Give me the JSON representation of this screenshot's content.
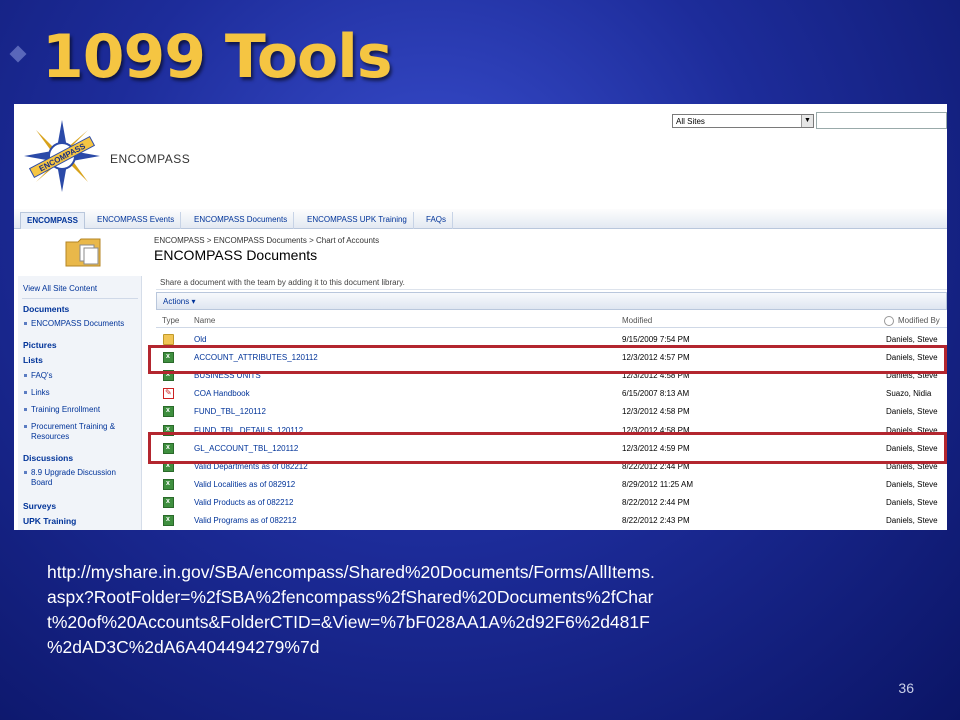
{
  "slide": {
    "title": "1099 Tools",
    "url": "http://myshare.in.gov/SBA/encompass/Shared%20Documents/Forms/AllItems.aspx?RootFolder=%2fSBA%2fencompass%2fShared%20Documents%2fChart%20of%20Accounts&FolderCTID=&View=%7bF028AA1A%2d92F6%2d481F%2dAD3C%2dA6A404494279%7d",
    "url_lines": [
      "http://myshare.in.gov/SBA/encompass/Shared%20Documents/Forms/AllItems.",
      "aspx?RootFolder=%2fSBA%2fencompass%2fShared%20Documents%2fChar",
      "t%20of%20Accounts&FolderCTID=&View=%7bF028AA1A%2d92F6%2d481F",
      "%2dAD3C%2dA6A404494279%7d"
    ],
    "page_number": "36",
    "colors": {
      "title": "#f5c542",
      "highlight": "#b3262f",
      "background": "#1d2c9a"
    }
  },
  "sharepoint": {
    "site_name": "ENCOMPASS",
    "logo_text": "ENCOMPASS",
    "search_scope": "All Sites",
    "tabs": [
      "ENCOMPASS",
      "ENCOMPASS Events",
      "ENCOMPASS Documents",
      "ENCOMPASS UPK Training",
      "FAQs"
    ],
    "active_tab": "ENCOMPASS",
    "breadcrumb": "ENCOMPASS > ENCOMPASS Documents > Chart of Accounts",
    "library_title": "ENCOMPASS Documents",
    "description": "Share a document with the team by adding it to this document library.",
    "actions_label": "Actions ▾",
    "columns": {
      "type": "Type",
      "name": "Name",
      "modified": "Modified",
      "modified_by": "Modified By"
    },
    "quicklaunch": {
      "view_all": "View All Site Content",
      "documents_head": "Documents",
      "documents_items": [
        "ENCOMPASS Documents"
      ],
      "pictures_head": "Pictures",
      "lists_head": "Lists",
      "lists_items": [
        "FAQ's",
        "Links",
        "Training Enrollment",
        "Procurement Training & Resources"
      ],
      "discussions_head": "Discussions",
      "discussions_items": [
        "8.9 Upgrade Discussion Board"
      ],
      "surveys_head": "Surveys",
      "upk_head": "UPK Training"
    },
    "rows": [
      {
        "icon": "folder",
        "name": "Old",
        "modified": "9/15/2009 7:54 PM",
        "by": "Daniels, Steve"
      },
      {
        "icon": "xls",
        "name": "ACCOUNT_ATTRIBUTES_120112",
        "modified": "12/3/2012 4:57 PM",
        "by": "Daniels, Steve"
      },
      {
        "icon": "xls",
        "name": "BUSINESS UNITS",
        "modified": "12/3/2012 4:58 PM",
        "by": "Daniels, Steve"
      },
      {
        "icon": "pdf",
        "name": "COA Handbook",
        "modified": "6/15/2007 8:13 AM",
        "by": "Suazo, Nidia"
      },
      {
        "icon": "xls",
        "name": "FUND_TBL_120112",
        "modified": "12/3/2012 4:58 PM",
        "by": "Daniels, Steve"
      },
      {
        "icon": "xls",
        "name": "FUND_TBL_DETAILS_120112",
        "modified": "12/3/2012 4:58 PM",
        "by": "Daniels, Steve"
      },
      {
        "icon": "xls",
        "name": "GL_ACCOUNT_TBL_120112",
        "modified": "12/3/2012 4:59 PM",
        "by": "Daniels, Steve"
      },
      {
        "icon": "xls",
        "name": "Valid Departments as of 082212",
        "modified": "8/22/2012 2:44 PM",
        "by": "Daniels, Steve"
      },
      {
        "icon": "xls",
        "name": "Valid Localities as of 082912",
        "modified": "8/29/2012 11:25 AM",
        "by": "Daniels, Steve"
      },
      {
        "icon": "xls",
        "name": "Valid Products as of 082212",
        "modified": "8/22/2012 2:44 PM",
        "by": "Daniels, Steve"
      },
      {
        "icon": "xls",
        "name": "Valid Programs as of 082212",
        "modified": "8/22/2012 2:43 PM",
        "by": "Daniels, Steve"
      }
    ]
  }
}
